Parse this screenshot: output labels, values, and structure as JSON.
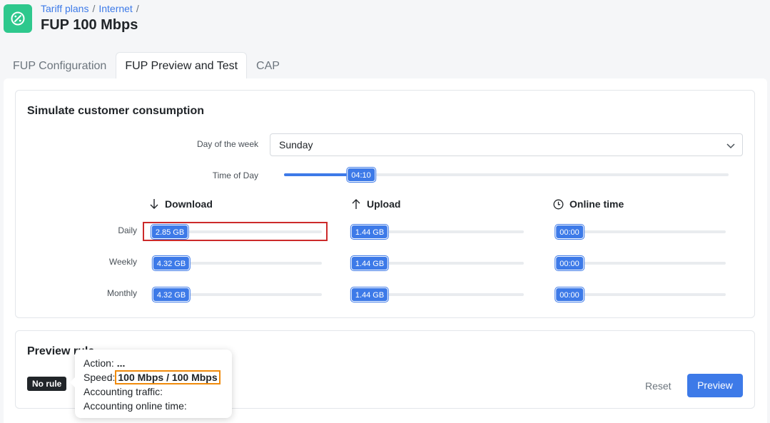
{
  "header": {
    "logo_icon": "percent-gauge-icon",
    "breadcrumb": [
      "Tariff plans",
      "Internet"
    ],
    "breadcrumb_separator": "/",
    "title": "FUP 100 Mbps"
  },
  "tabs": [
    {
      "label": "FUP Configuration",
      "active": false
    },
    {
      "label": "FUP Preview and Test",
      "active": true
    },
    {
      "label": "CAP",
      "active": false
    }
  ],
  "simulate": {
    "title": "Simulate customer consumption",
    "day_label": "Day of the week",
    "day_value": "Sunday",
    "time_label": "Time of Day",
    "time_value": "04:10",
    "columns": [
      {
        "label": "Download",
        "icon": "arrow-down-icon"
      },
      {
        "label": "Upload",
        "icon": "arrow-up-icon"
      },
      {
        "label": "Online time",
        "icon": "clock-icon"
      }
    ],
    "rows": [
      {
        "label": "Daily",
        "values": [
          "2.85 GB",
          "1.44 GB",
          "00:00"
        ]
      },
      {
        "label": "Weekly",
        "values": [
          "4.32 GB",
          "1.44 GB",
          "00:00"
        ]
      },
      {
        "label": "Monthly",
        "values": [
          "4.32 GB",
          "1.44 GB",
          "00:00"
        ]
      }
    ]
  },
  "preview": {
    "title": "Preview rule",
    "badge": "No rule",
    "tooltip": {
      "action_label": "Action:",
      "action_value": "...",
      "speed_label": "Speed:",
      "speed_value": "100 Mbps / 100 Mbps",
      "accounting_traffic_label": "Accounting traffic:",
      "accounting_online_label": "Accounting online time:"
    },
    "reset_label": "Reset",
    "preview_label": "Preview"
  },
  "colors": {
    "accent": "#3d7ae8",
    "logo": "#2ec88d",
    "highlight_red": "#cc2a2a",
    "highlight_orange": "#f08a0b"
  }
}
